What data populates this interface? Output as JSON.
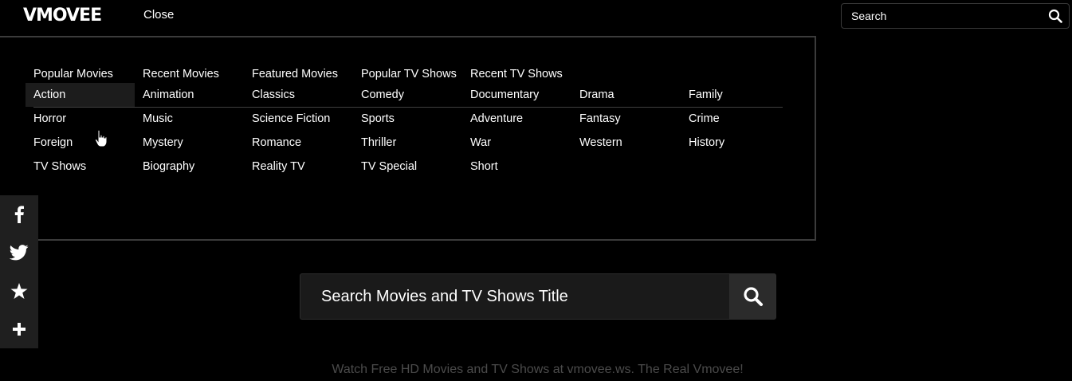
{
  "header": {
    "logo": "VMOVEE",
    "close_label": "Close",
    "search_placeholder": "Search"
  },
  "menu": {
    "top_links": [
      "Popular Movies",
      "Recent Movies",
      "Featured Movies",
      "Popular TV Shows",
      "Recent TV Shows"
    ],
    "genres": [
      [
        "Action",
        "Animation",
        "Classics",
        "Comedy",
        "Documentary",
        "Drama",
        "Family"
      ],
      [
        "Horror",
        "Music",
        "Science Fiction",
        "Sports",
        "Adventure",
        "Fantasy",
        "Crime"
      ],
      [
        "Foreign",
        "Mystery",
        "Romance",
        "Thriller",
        "War",
        "Western",
        "History"
      ],
      [
        "TV Shows",
        "Biography",
        "Reality TV",
        "TV Special",
        "Short"
      ]
    ],
    "active_genre": "Action"
  },
  "share_bar": {
    "icons": [
      "facebook-icon",
      "twitter-icon",
      "star-icon",
      "plus-icon"
    ]
  },
  "main_search": {
    "placeholder": "Search Movies and TV Shows Title"
  },
  "footer": {
    "tagline": "Watch Free HD Movies and TV Shows at vmovee.ws. The Real Vmovee!"
  },
  "colors": {
    "background": "#000000",
    "panel_border": "#3b3b3b",
    "active_item": "#1c1c1c",
    "share_bar": "#1f1f1f",
    "tagline": "#4b4b4b"
  }
}
